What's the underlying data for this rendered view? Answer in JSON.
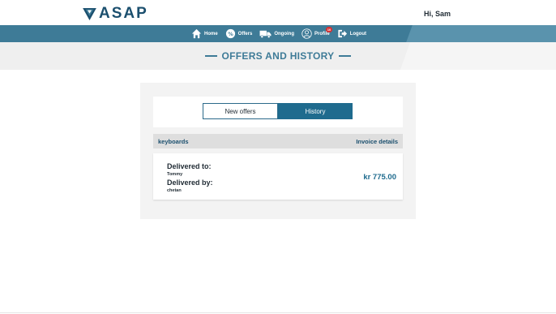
{
  "app": {
    "logo_text": "ASAP",
    "greeting": "Hi, Sam"
  },
  "nav": {
    "items": [
      {
        "label": "Home",
        "icon": "home-icon"
      },
      {
        "label": "Offers",
        "icon": "percent-icon"
      },
      {
        "label": "Ongoing",
        "icon": "truck-icon"
      },
      {
        "label": "Profile",
        "icon": "user-icon",
        "badge": "10"
      },
      {
        "label": "Logout",
        "icon": "logout-icon"
      }
    ]
  },
  "page": {
    "title": "OFFERS AND HISTORY"
  },
  "tabs": {
    "new_offers": "New offers",
    "history": "History",
    "active": "history"
  },
  "order": {
    "item_name": "keyboards",
    "invoice_link": "Invoice details",
    "delivered_to_label": "Delivered to:",
    "delivered_to": "Tommy",
    "delivered_by_label": "Delivered by:",
    "delivered_by": "chetan",
    "amount": "kr 775.00"
  },
  "colors": {
    "primary": "#3e7b97",
    "accent": "#1f6b8e",
    "badge": "#d63031"
  }
}
